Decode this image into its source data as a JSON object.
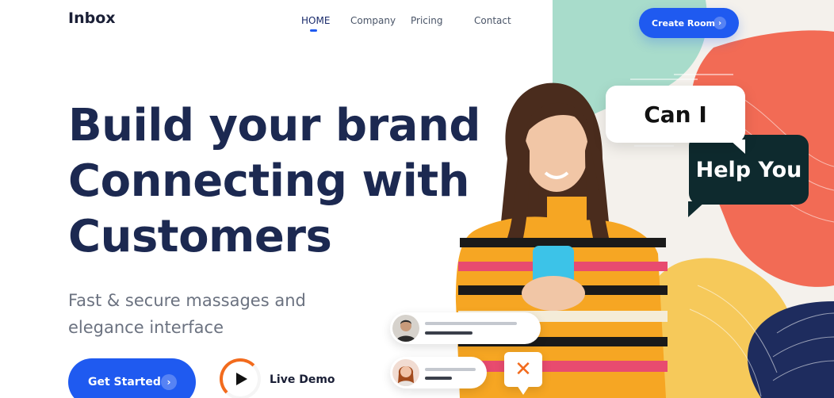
{
  "header": {
    "logo": "Inbox",
    "nav": [
      {
        "label": "HOME",
        "active": true
      },
      {
        "label": "Company",
        "active": false
      },
      {
        "label": "Pricing",
        "active": false
      },
      {
        "label": "Contact",
        "active": false
      }
    ],
    "cta_label": "Create Room",
    "cta_icon": "chevron-right-icon"
  },
  "hero": {
    "title_line1": "Build your brand",
    "title_line2": "Connecting with",
    "title_line3": "Customers",
    "subtitle_line1": "Fast & secure massages and",
    "subtitle_line2": "elegance interface",
    "primary_button": "Get Started",
    "demo_label": "Live Demo"
  },
  "illustration": {
    "bubble1": "Can I",
    "bubble2": "Help You",
    "close_icon": "close-icon"
  },
  "colors": {
    "accent": "#1f5af0",
    "heading": "#1c2951",
    "orange": "#f26b1d",
    "mint": "#a8dccb",
    "coral": "#f26b55",
    "yellow": "#f6c95a",
    "navy": "#1e2c5e",
    "dark_bubble": "#0e2a2e"
  }
}
